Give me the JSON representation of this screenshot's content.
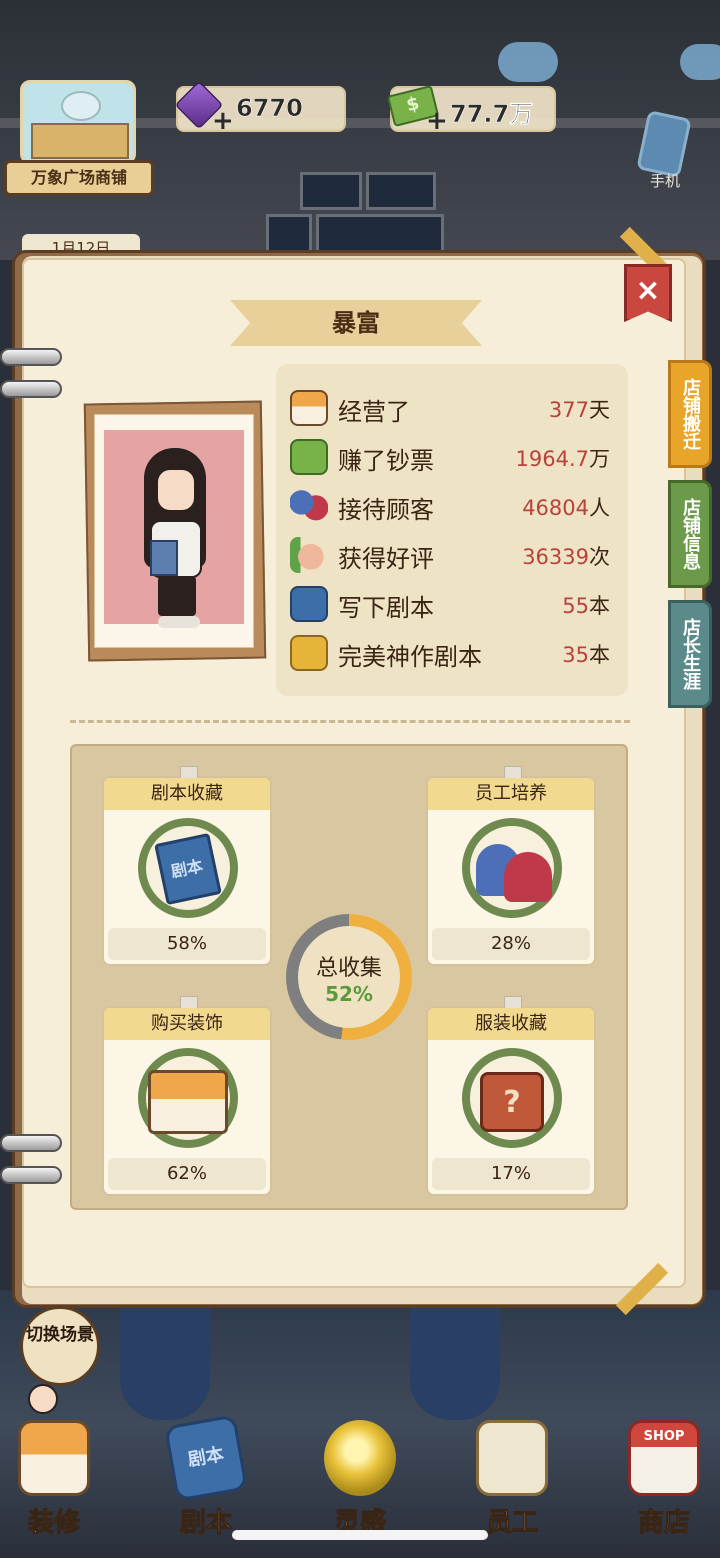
{
  "hud": {
    "shop_name": "万象广场商铺",
    "date": "1月12日",
    "gems": "6770",
    "money": "77.7万",
    "phone_label": "手机"
  },
  "panel": {
    "title": "暴富",
    "close_icon": "close-icon",
    "stats": [
      {
        "icon": "house-icon",
        "label": "经营了",
        "value": "377",
        "unit": "天"
      },
      {
        "icon": "money-icon",
        "label": "赚了钞票",
        "value": "1964.7",
        "unit": "万"
      },
      {
        "icon": "people-icon",
        "label": "接待顾客",
        "value": "46804",
        "unit": "人"
      },
      {
        "icon": "thumbs-up-icon",
        "label": "获得好评",
        "value": "36339",
        "unit": "次"
      },
      {
        "icon": "script-book-icon",
        "label": "写下剧本",
        "value": "55",
        "unit": "本"
      },
      {
        "icon": "gold-script-icon",
        "label": "完美神作剧本",
        "value": "35",
        "unit": "本"
      }
    ],
    "collections": [
      {
        "title": "剧本收藏",
        "percent": "58%",
        "icon": "script-book-icon",
        "art_text": "剧本"
      },
      {
        "title": "员工培养",
        "percent": "28%",
        "icon": "people-icon"
      },
      {
        "title": "购买装饰",
        "percent": "62%",
        "icon": "house-icon"
      },
      {
        "title": "服装收藏",
        "percent": "17%",
        "icon": "shirt-icon",
        "art_text": "?"
      }
    ],
    "total": {
      "label": "总收集",
      "percent": "52%",
      "fraction": 0.52
    }
  },
  "side_tabs": [
    {
      "label": "店铺搬迁",
      "color": "#e9a42a"
    },
    {
      "label": "店铺信息",
      "color": "#6a9a4a"
    },
    {
      "label": "店长生涯",
      "color": "#5a8a8a"
    }
  ],
  "bottom": {
    "switch_scene": "切换场景",
    "nav": [
      {
        "label": "装修",
        "icon": "decor-icon"
      },
      {
        "label": "剧本",
        "icon": "script-book-icon",
        "icon_text": "剧本"
      },
      {
        "label": "灵感",
        "icon": "idea-bulb-icon"
      },
      {
        "label": "员工",
        "icon": "staff-card-icon"
      },
      {
        "label": "商店",
        "icon": "shop-icon",
        "icon_text": "SHOP"
      }
    ]
  },
  "colors": {
    "accent_gold": "#f0b040",
    "value_red": "#b8423a",
    "progress_green": "#5b9a3a",
    "close_red": "#c9473f"
  }
}
